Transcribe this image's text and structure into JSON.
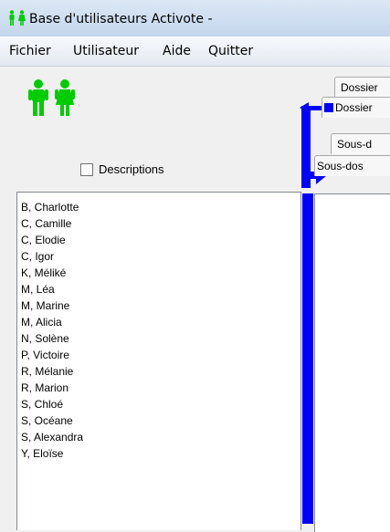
{
  "window": {
    "title": "Base d'utilisateurs Activote -"
  },
  "menu": [
    "Fichier",
    "Utilisateur",
    "Aide",
    "Quitter"
  ],
  "logo": {
    "icon": "users-icon",
    "color": "#00cc00"
  },
  "descriptions": {
    "label": "Descriptions",
    "checked": false
  },
  "users": [
    "B, Charlotte",
    "C, Camille",
    "C, Elodie",
    "C, Igor",
    "K, Méliké",
    "M, Léa",
    "M, Marine",
    "M, Alicia",
    "N, Solène",
    "P, Victoire",
    "R, Mélanie",
    "R, Marion",
    "S, Chloé",
    "S, Océane",
    "S, Alexandra",
    "Y, Eloïse"
  ],
  "tabs": {
    "row1": [
      "Dossier",
      "Dossier"
    ],
    "row2": [
      "Sous-d",
      "Sous-dos"
    ],
    "selected_marker_color": "#0000ff"
  },
  "accent": "#0000ff"
}
